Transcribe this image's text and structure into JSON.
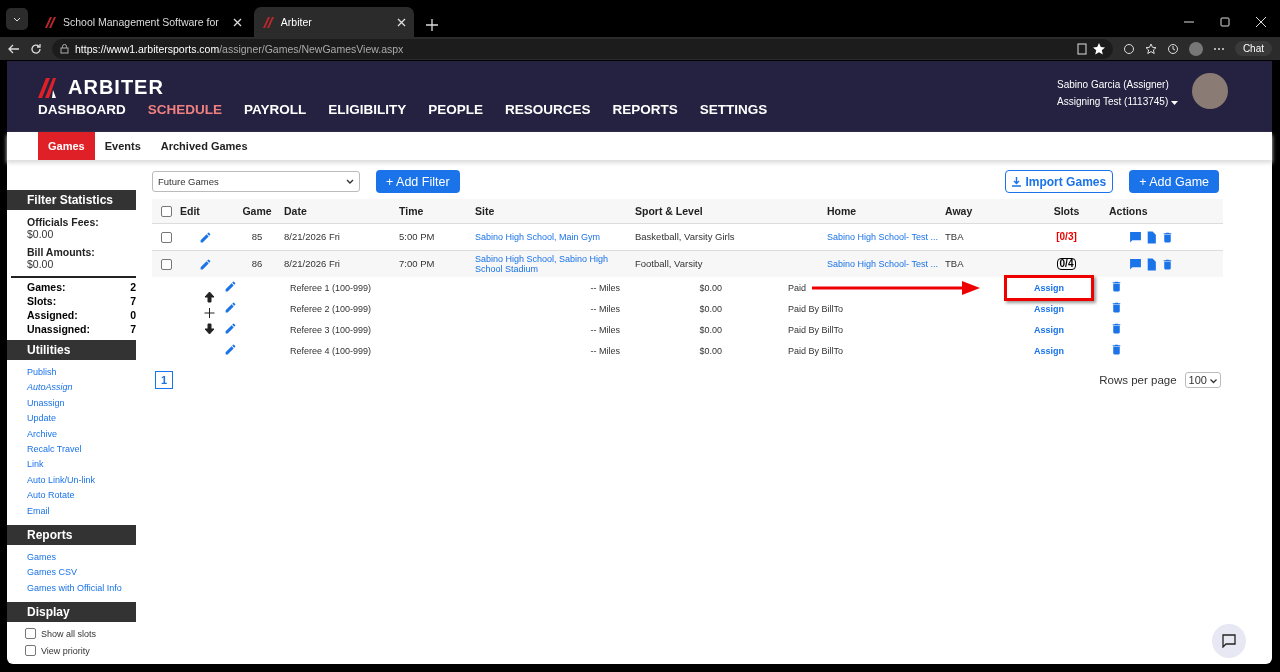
{
  "browser": {
    "tabs": [
      {
        "title": "School Management Software for",
        "selected": false
      },
      {
        "title": "Arbiter",
        "selected": true
      }
    ],
    "url_host": "https://www1.arbitersports.com",
    "url_path": "/assigner/Games/NewGamesView.aspx",
    "chat_label": "Chat"
  },
  "header": {
    "logo": "ARBITER",
    "nav": [
      {
        "label": "DASHBOARD",
        "selected": false
      },
      {
        "label": "SCHEDULE",
        "selected": true
      },
      {
        "label": "PAYROLL",
        "selected": false
      },
      {
        "label": "ELIGIBILITY",
        "selected": false
      },
      {
        "label": "PEOPLE",
        "selected": false
      },
      {
        "label": "RESOURCES",
        "selected": false
      },
      {
        "label": "REPORTS",
        "selected": false
      },
      {
        "label": "SETTINGS",
        "selected": false
      }
    ],
    "user_name": "Sabino Garcia (Assigner)",
    "account": "Assigning Test (1113745)"
  },
  "subtabs": [
    {
      "label": "Games",
      "selected": true
    },
    {
      "label": "Events",
      "selected": false
    },
    {
      "label": "Archived Games",
      "selected": false
    }
  ],
  "sidebar": {
    "filter_statistics": {
      "title": "Filter Statistics",
      "fees": [
        {
          "label": "Officials Fees:",
          "value": "$0.00"
        },
        {
          "label": "Bill Amounts:",
          "value": "$0.00"
        }
      ],
      "counts": [
        {
          "label": "Games:",
          "value": "2"
        },
        {
          "label": "Slots:",
          "value": "7"
        },
        {
          "label": "Assigned:",
          "value": "0"
        },
        {
          "label": "Unassigned:",
          "value": "7"
        }
      ]
    },
    "utilities": {
      "title": "Utilities",
      "links": [
        {
          "label": "Publish",
          "italic": false
        },
        {
          "label": "AutoAssign",
          "italic": true
        },
        {
          "label": "Unassign",
          "italic": false
        },
        {
          "label": "Update",
          "italic": false
        },
        {
          "label": "Archive",
          "italic": false
        },
        {
          "label": "Recalc Travel",
          "italic": false
        },
        {
          "label": "Link",
          "italic": false
        },
        {
          "label": "Auto Link/Un-link",
          "italic": false
        },
        {
          "label": "Auto Rotate",
          "italic": false
        },
        {
          "label": "Email",
          "italic": false
        }
      ]
    },
    "reports": {
      "title": "Reports",
      "links": [
        "Games",
        "Games CSV",
        "Games with Official Info"
      ]
    },
    "display": {
      "title": "Display",
      "options": [
        {
          "label": "Show all slots",
          "checked": false
        },
        {
          "label": "View priority",
          "checked": false
        }
      ]
    }
  },
  "toolbar": {
    "filter_select": "Future Games",
    "add_filter": "+ Add Filter",
    "import_games": "Import Games",
    "add_game": "+ Add Game"
  },
  "table": {
    "select_all_checked": false,
    "columns": [
      "Edit",
      "Game",
      "Date",
      "Time",
      "Site",
      "Sport & Level",
      "Home",
      "Away",
      "Slots",
      "Actions"
    ],
    "rows": [
      {
        "checked": false,
        "game": "85",
        "date": "8/21/2026 Fri",
        "time": "5:00 PM",
        "site": "Sabino High School, Main Gym",
        "sport_level": "Basketball, Varsity Girls",
        "home": "Sabino High School- Test ...",
        "away": "TBA",
        "slots": "[0/3]",
        "outlined": false
      },
      {
        "checked": false,
        "game": "86",
        "date": "8/21/2026 Fri",
        "time": "7:00 PM",
        "site": "Sabino High School, Sabino High School Stadium",
        "sport_level": "Football, Varsity",
        "home": "Sabino High School- Test ...",
        "away": "TBA",
        "slots": "0/4",
        "outlined": true
      }
    ],
    "slots": [
      {
        "position": "Referee 1 (100-999)",
        "miles": "-- Miles",
        "fee": "$0.00",
        "paid_by": "Paid",
        "action": "Assign",
        "highlighted": true
      },
      {
        "position": "Referee 2 (100-999)",
        "miles": "-- Miles",
        "fee": "$0.00",
        "paid_by": "Paid By BillTo",
        "action": "Assign",
        "highlighted": false
      },
      {
        "position": "Referee 3 (100-999)",
        "miles": "-- Miles",
        "fee": "$0.00",
        "paid_by": "Paid By BillTo",
        "action": "Assign",
        "highlighted": false
      },
      {
        "position": "Referee 4 (100-999)",
        "miles": "-- Miles",
        "fee": "$0.00",
        "paid_by": "Paid By BillTo",
        "action": "Assign",
        "highlighted": false
      }
    ]
  },
  "pagination": {
    "pages": [
      {
        "label": "1",
        "selected": true
      }
    ],
    "rows_per_page_label": "Rows per page",
    "rows_per_page": "100"
  }
}
